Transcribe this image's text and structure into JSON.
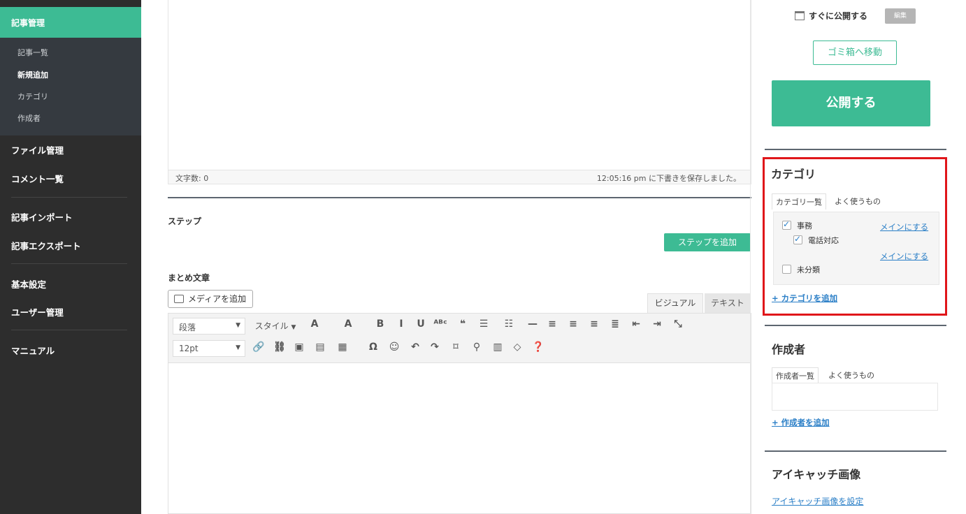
{
  "sidebar": {
    "active_section": "記事管理",
    "sub_items": [
      {
        "label": "記事一覧",
        "current": false
      },
      {
        "label": "新規追加",
        "current": true
      },
      {
        "label": "カテゴリ",
        "current": false
      },
      {
        "label": "作成者",
        "current": false
      }
    ],
    "items": [
      {
        "label": "ファイル管理"
      },
      {
        "label": "コメント一覧"
      },
      {
        "label": "記事インポート"
      },
      {
        "label": "記事エクスポート"
      },
      {
        "label": "基本設定"
      },
      {
        "label": "ユーザー管理"
      },
      {
        "label": "マニュアル"
      }
    ]
  },
  "editor": {
    "word_count": "文字数: 0",
    "saved_status": "12:05:16 pm に下書きを保存しました。"
  },
  "steps": {
    "label": "ステップ",
    "add_button": "ステップを追加"
  },
  "summary": {
    "label": "まとめ文章",
    "media_button": "メディアを追加",
    "tab_visual": "ビジュアル",
    "tab_text": "テキスト",
    "paragraph_select": "段落",
    "style_select": "スタイル",
    "font_size_select": "12pt"
  },
  "toolbar": {
    "row1": [
      {
        "icon": "text-color-icon",
        "glyph": "A"
      },
      {
        "icon": "background-color-icon",
        "glyph": "A"
      },
      {
        "icon": "bold-icon",
        "glyph": "B"
      },
      {
        "icon": "italic-icon",
        "glyph": "I"
      },
      {
        "icon": "underline-icon",
        "glyph": "U"
      },
      {
        "icon": "strikethrough-icon",
        "glyph": "ᴬᴮᶜ"
      },
      {
        "icon": "blockquote-icon",
        "glyph": "❝"
      },
      {
        "icon": "bullet-list-icon",
        "glyph": "☰"
      },
      {
        "icon": "numbered-list-icon",
        "glyph": "☷"
      },
      {
        "icon": "horizontal-line-icon",
        "glyph": "—"
      },
      {
        "icon": "align-left-icon",
        "glyph": "≡"
      },
      {
        "icon": "align-center-icon",
        "glyph": "≡"
      },
      {
        "icon": "align-right-icon",
        "glyph": "≡"
      },
      {
        "icon": "justify-icon",
        "glyph": "≣"
      },
      {
        "icon": "outdent-icon",
        "glyph": "⇤"
      },
      {
        "icon": "indent-icon",
        "glyph": "⇥"
      },
      {
        "icon": "fullscreen-icon",
        "glyph": "⤡"
      }
    ],
    "row2": [
      {
        "icon": "link-icon",
        "glyph": "🔗"
      },
      {
        "icon": "unlink-icon",
        "glyph": "⛓"
      },
      {
        "icon": "image-icon",
        "glyph": "▣"
      },
      {
        "icon": "video-icon",
        "glyph": "▤"
      },
      {
        "icon": "table-icon",
        "glyph": "▦"
      },
      {
        "icon": "special-char-icon",
        "glyph": "Ω"
      },
      {
        "icon": "emoji-icon",
        "glyph": "☺"
      },
      {
        "icon": "undo-icon",
        "glyph": "↶"
      },
      {
        "icon": "redo-icon",
        "glyph": "↷"
      },
      {
        "icon": "bookmark-icon",
        "glyph": "⌑"
      },
      {
        "icon": "find-icon",
        "glyph": "⚲"
      },
      {
        "icon": "paste-icon",
        "glyph": "▥"
      },
      {
        "icon": "clear-format-icon",
        "glyph": "◇"
      },
      {
        "icon": "help-icon",
        "glyph": "❓"
      }
    ]
  },
  "publish": {
    "publish_now": "すぐに公開する",
    "edit_badge": "編集",
    "trash_button": "ゴミ箱へ移動",
    "publish_button": "公開する"
  },
  "category": {
    "heading": "カテゴリ",
    "tab_all": "カテゴリ一覧",
    "tab_popular": "よく使うもの",
    "items": [
      {
        "label": "事務",
        "checked": true,
        "main_link": "メインにする"
      },
      {
        "label": "電話対応",
        "checked": true,
        "main_link": "メインにする"
      },
      {
        "label": "未分類",
        "checked": false
      }
    ],
    "add_link": "+ カテゴリを追加"
  },
  "author": {
    "heading": "作成者",
    "tab_all": "作成者一覧",
    "tab_popular": "よく使うもの",
    "add_link": "+ 作成者を追加"
  },
  "eyecatch": {
    "heading": "アイキャッチ画像",
    "set_link": "アイキャッチ画像を設定"
  },
  "colors": {
    "accent": "#3dbb94",
    "sidebar_bg": "#2d2d2d",
    "highlight_border": "#e0161a",
    "link": "#2b7fc7"
  }
}
